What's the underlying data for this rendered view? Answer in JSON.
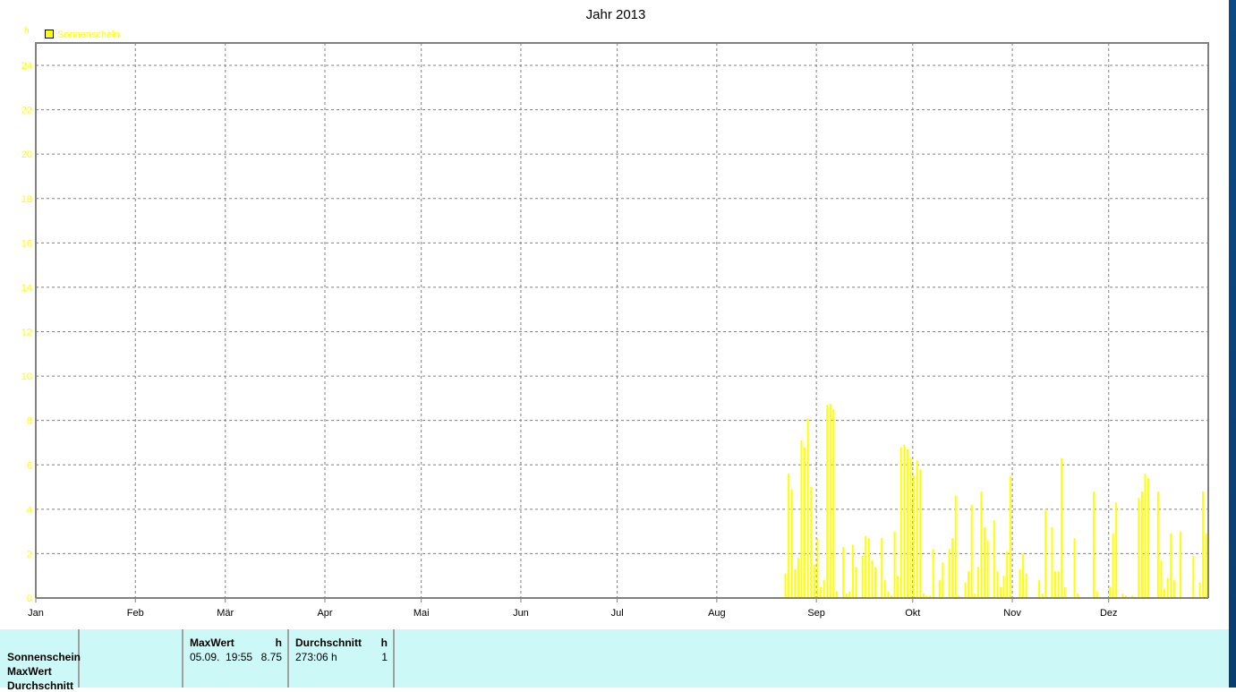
{
  "chart_data": {
    "type": "bar",
    "title": "Jahr 2013",
    "year": 2013,
    "ylabel": "h",
    "ylim": [
      0,
      24
    ],
    "yticks": [
      0,
      2,
      4,
      6,
      8,
      10,
      12,
      14,
      16,
      18,
      20,
      22,
      24
    ],
    "xticks": [
      "Jan",
      "Feb",
      "Mär",
      "Apr",
      "Mai",
      "Jun",
      "Jul",
      "Aug",
      "Sep",
      "Okt",
      "Nov",
      "Dez"
    ],
    "grid": true,
    "legend": {
      "placement": "top-left",
      "entries": [
        "Sonnenschein"
      ]
    },
    "colors": {
      "series": "#ffff00",
      "axis": "#808080",
      "grid": "#808080",
      "tick_labels": "#ffff00"
    },
    "series": [
      {
        "name": "Sonnenschein",
        "points": [
          [
            "08-22",
            1.1
          ],
          [
            "08-23",
            5.6
          ],
          [
            "08-24",
            4.9
          ],
          [
            "08-25",
            1.3
          ],
          [
            "08-26",
            1.8
          ],
          [
            "08-27",
            7.1
          ],
          [
            "08-28",
            6.8
          ],
          [
            "08-29",
            8.1
          ],
          [
            "08-30",
            5.0
          ],
          [
            "08-31",
            1.5
          ],
          [
            "09-01",
            2.7
          ],
          [
            "09-02",
            0.5
          ],
          [
            "09-03",
            0.8
          ],
          [
            "09-04",
            8.7
          ],
          [
            "09-05",
            8.75
          ],
          [
            "09-06",
            8.5
          ],
          [
            "09-07",
            0.3
          ],
          [
            "09-09",
            2.3
          ],
          [
            "09-10",
            0.2
          ],
          [
            "09-11",
            0.3
          ],
          [
            "09-12",
            2.4
          ],
          [
            "09-13",
            1.4
          ],
          [
            "09-15",
            1.9
          ],
          [
            "09-16",
            2.8
          ],
          [
            "09-17",
            2.7
          ],
          [
            "09-18",
            1.7
          ],
          [
            "09-19",
            1.4
          ],
          [
            "09-21",
            2.7
          ],
          [
            "09-22",
            0.8
          ],
          [
            "09-23",
            0.3
          ],
          [
            "09-24",
            0.1
          ],
          [
            "09-25",
            3.0
          ],
          [
            "09-26",
            1.0
          ],
          [
            "09-27",
            6.8
          ],
          [
            "09-28",
            6.9
          ],
          [
            "09-29",
            6.7
          ],
          [
            "09-30",
            6.3
          ],
          [
            "10-01",
            5.5
          ],
          [
            "10-02",
            6.2
          ],
          [
            "10-03",
            5.8
          ],
          [
            "10-04",
            0.2
          ],
          [
            "10-05",
            0.1
          ],
          [
            "10-06",
            0.1
          ],
          [
            "10-07",
            2.2
          ],
          [
            "10-09",
            0.8
          ],
          [
            "10-10",
            1.6
          ],
          [
            "10-12",
            2.2
          ],
          [
            "10-13",
            2.7
          ],
          [
            "10-14",
            4.6
          ],
          [
            "10-15",
            0.1
          ],
          [
            "10-17",
            0.7
          ],
          [
            "10-18",
            1.2
          ],
          [
            "10-19",
            4.2
          ],
          [
            "10-20",
            0.2
          ],
          [
            "10-21",
            1.4
          ],
          [
            "10-22",
            4.8
          ],
          [
            "10-23",
            3.2
          ],
          [
            "10-24",
            2.6
          ],
          [
            "10-26",
            3.5
          ],
          [
            "10-27",
            1.2
          ],
          [
            "10-28",
            0.5
          ],
          [
            "10-29",
            1.0
          ],
          [
            "10-30",
            2.1
          ],
          [
            "10-31",
            5.5
          ],
          [
            "11-03",
            1.3
          ],
          [
            "11-04",
            2.0
          ],
          [
            "11-05",
            1.1
          ],
          [
            "11-09",
            0.8
          ],
          [
            "11-10",
            0.2
          ],
          [
            "11-11",
            4.0
          ],
          [
            "11-13",
            3.2
          ],
          [
            "11-14",
            1.2
          ],
          [
            "11-15",
            1.2
          ],
          [
            "11-16",
            6.3
          ],
          [
            "11-17",
            0.5
          ],
          [
            "11-20",
            2.7
          ],
          [
            "11-21",
            0.2
          ],
          [
            "11-26",
            4.8
          ],
          [
            "11-27",
            0.3
          ],
          [
            "12-01",
            0.5
          ],
          [
            "12-02",
            2.9
          ],
          [
            "12-03",
            4.3
          ],
          [
            "12-05",
            0.2
          ],
          [
            "12-06",
            0.1
          ],
          [
            "12-08",
            0.1
          ],
          [
            "12-10",
            4.5
          ],
          [
            "12-11",
            4.8
          ],
          [
            "12-12",
            5.6
          ],
          [
            "12-13",
            5.4
          ],
          [
            "12-16",
            4.8
          ],
          [
            "12-17",
            1.7
          ],
          [
            "12-18",
            0.4
          ],
          [
            "12-19",
            0.9
          ],
          [
            "12-20",
            2.9
          ],
          [
            "12-21",
            0.8
          ],
          [
            "12-23",
            3.0
          ],
          [
            "12-27",
            1.9
          ],
          [
            "12-29",
            0.7
          ],
          [
            "12-30",
            4.8
          ],
          [
            "12-31",
            2.9
          ]
        ]
      }
    ]
  },
  "table": {
    "row_labels": [
      "Sonnenschein",
      "MaxWert",
      "Durchschnitt"
    ],
    "max": {
      "header": "MaxWert",
      "unit": "h",
      "date": "05.09.  19:55",
      "value": "8.75"
    },
    "avg": {
      "header": "Durchschnitt",
      "unit": "h",
      "value": "273:06 h",
      "count": "1"
    }
  }
}
